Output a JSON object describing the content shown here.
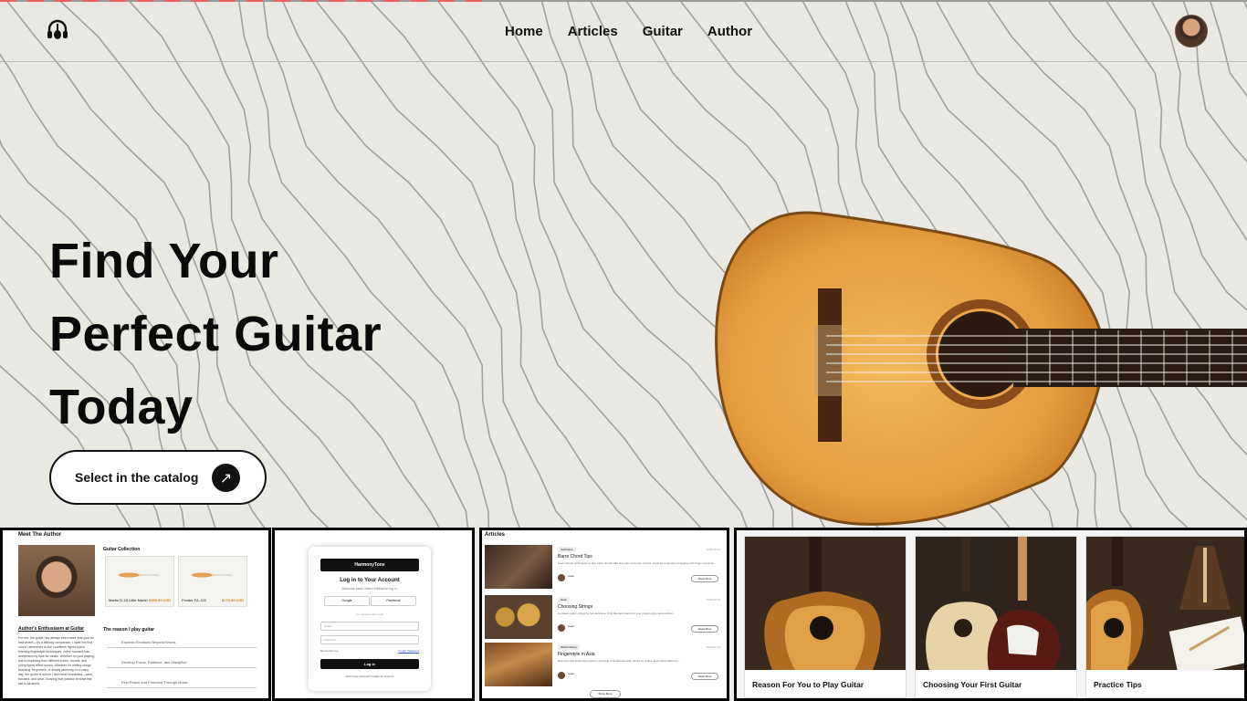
{
  "header": {
    "logo_icon": "headphones-guitar-logo-icon",
    "nav": [
      "Home",
      "Articles",
      "Guitar",
      "Author"
    ],
    "avatar_icon": "user-avatar-icon"
  },
  "hero": {
    "headline": [
      "Find Your",
      "Perfect Guitar",
      "Today"
    ],
    "cta_label": "Select in the catalog",
    "cta_icon": "arrow-up-right-icon",
    "image": "classical-guitar-image"
  },
  "thumbnails": {
    "author": {
      "title": "Meet The Author",
      "collection_title": "Guitar Collection",
      "products": [
        {
          "name": "Martin D-18 Little Martin",
          "price": "$499.99 USD"
        },
        {
          "name": "Fender FA-125",
          "price": "$179.99 USD"
        }
      ],
      "enthusiasm_title": "Author's Enthusiasm at Guitar",
      "enthusiasm_text": "For me, the guitar has always been more than just an instrument—it's a lifelong companion. I have the first chord I strummed to the countless nights spent learning fingerstyle techniques, every moment has deepened my love for music. Whether I'm just playing, lost in exploring how different tones, moods, and string types affect sound. Whether it's writing songs, teaching, beginners, or simply jamming on a rainy day, the guitar is where I feel most connected—calm, focused, and alive. Sharing that passion is what this site is all about.",
      "reasons_title": "The reason I play guitar",
      "reasons": [
        "Express Emotions Beyond Words",
        "Develop Focus, Patience, and Discipline",
        "Find Peace and Freedom Through Music"
      ]
    },
    "login": {
      "brand": "HarmonyTone",
      "title": "Log in to Your Account",
      "subtitle": "Welcome back! Select method to log in:",
      "google": "Google",
      "facebook": "Facebook",
      "divider": "Or continue with email",
      "email_placeholder": "Email",
      "password_placeholder": "Password",
      "remember": "Remember me",
      "forgot": "Forgot Password",
      "login_button": "Log In",
      "footer": "Don't have account? Create an account"
    },
    "articles": {
      "title": "Articles",
      "items": [
        {
          "tag": "Technique",
          "date": "2025-02-16",
          "title": "Barre Chord Tips",
          "excerpt": "Learn simple techniques to play barre chords with less pain and more control. Great for beginners struggling with finger pressure...",
          "author": "Isaac",
          "more": "Read More"
        },
        {
          "tag": "Gear",
          "date": "2025-03-05",
          "title": "Choosing Strings",
          "excerpt": "Compare guitar strings by feel and tone. Find the best match for your playing style and comfort...",
          "author": "Isaac",
          "more": "Read More"
        },
        {
          "tag": "World History",
          "date": "2025-03-10",
          "title": "Fingerstyle in Asia",
          "excerpt": "Discover how fingerstyle guitar is booming in Southeast Asia, fueled by culture and online platforms...",
          "author": "Isaac",
          "more": "Read More"
        }
      ],
      "show_more": "Show More"
    },
    "cards": [
      "Reason For You to Play Guitar",
      "Choosing Your First Guitar",
      "Practice Tips"
    ]
  }
}
